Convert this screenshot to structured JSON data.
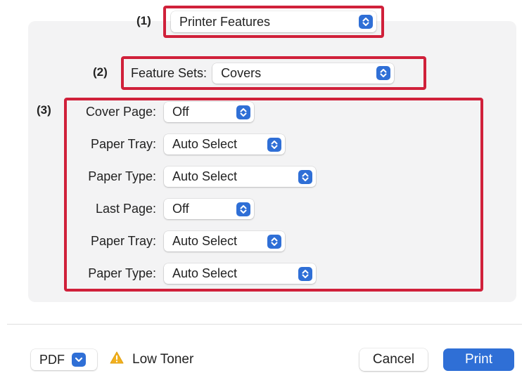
{
  "markers": {
    "m1": "(1)",
    "m2": "(2)",
    "m3": "(3)"
  },
  "preset_popup": {
    "value": "Printer Features"
  },
  "feature_sets": {
    "label": "Feature Sets:",
    "value": "Covers"
  },
  "cover_rows": [
    {
      "label": "Cover Page:",
      "value": "Off"
    },
    {
      "label": "Paper Tray:",
      "value": "Auto Select"
    },
    {
      "label": "Paper Type:",
      "value": "Auto Select"
    },
    {
      "label": "Last Page:",
      "value": "Off"
    },
    {
      "label": "Paper Tray:",
      "value": "Auto Select"
    },
    {
      "label": "Paper Type:",
      "value": "Auto Select"
    }
  ],
  "footer": {
    "pdf_label": "PDF",
    "warning_text": "Low Toner",
    "cancel_label": "Cancel",
    "print_label": "Print"
  },
  "colors": {
    "accent": "#2f6fd6",
    "callout": "#d0203a",
    "warning": "#f2b01e",
    "panel": "#f3f3f4"
  },
  "icons": {
    "popup_arrows": "up-down-chevron-icon",
    "pdf_menu": "chevron-down-icon",
    "warning": "warning-triangle-icon"
  }
}
